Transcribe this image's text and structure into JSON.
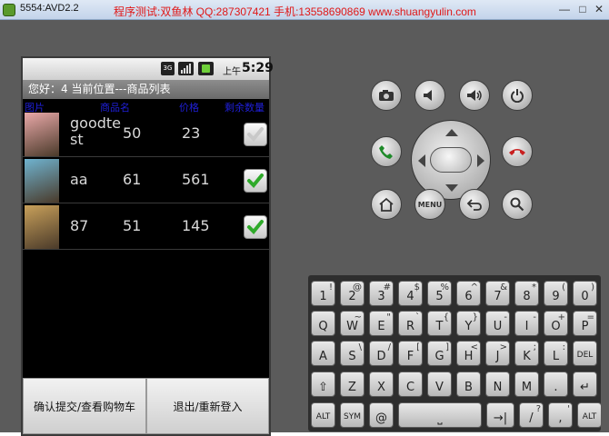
{
  "window": {
    "title": "5554:AVD2.2",
    "overlay": "程序测试:双鱼林 QQ:287307421 手机:13558690869 www.shuangyulin.com",
    "min_glyph": "—",
    "max_glyph": "□",
    "close_glyph": "✕"
  },
  "statusbar": {
    "network": "3G",
    "ampm": "上午",
    "time": "5:29"
  },
  "app": {
    "title_bar": "您好：4   当前位置---商品列表",
    "columns": [
      "图片",
      "商品名",
      "价格",
      "剩余数量"
    ],
    "rows": [
      {
        "name": "goodte st",
        "qty": "50",
        "price": "23",
        "checked": false,
        "thumb_color": "#e9a8a8"
      },
      {
        "name": "aa",
        "qty": "61",
        "price": "561",
        "checked": true,
        "thumb_color": "#6fb3d0"
      },
      {
        "name": "87",
        "qty": "51",
        "price": "145",
        "checked": true,
        "thumb_color": "#c8a05a"
      }
    ],
    "buttons": {
      "confirm": "确认提交/查看购物车",
      "logout": "退出/重新登入"
    }
  },
  "hardware": {
    "menu_label": "MENU"
  },
  "keyboard": {
    "rows": [
      [
        {
          "m": "1",
          "a": "!"
        },
        {
          "m": "2",
          "a": "@"
        },
        {
          "m": "3",
          "a": "#"
        },
        {
          "m": "4",
          "a": "$"
        },
        {
          "m": "5",
          "a": "%"
        },
        {
          "m": "6",
          "a": "^"
        },
        {
          "m": "7",
          "a": "&"
        },
        {
          "m": "8",
          "a": "*"
        },
        {
          "m": "9",
          "a": "("
        },
        {
          "m": "0",
          "a": ")"
        }
      ],
      [
        {
          "m": "Q",
          "a": ""
        },
        {
          "m": "W",
          "a": "~"
        },
        {
          "m": "E",
          "a": "\""
        },
        {
          "m": "R",
          "a": "`"
        },
        {
          "m": "T",
          "a": "{"
        },
        {
          "m": "Y",
          "a": "}"
        },
        {
          "m": "U",
          "a": "-"
        },
        {
          "m": "I",
          "a": "-"
        },
        {
          "m": "O",
          "a": "+"
        },
        {
          "m": "P",
          "a": "="
        }
      ],
      [
        {
          "m": "A",
          "a": ""
        },
        {
          "m": "S",
          "a": "\\"
        },
        {
          "m": "D",
          "a": "/"
        },
        {
          "m": "F",
          "a": "["
        },
        {
          "m": "G",
          "a": "]"
        },
        {
          "m": "H",
          "a": "<"
        },
        {
          "m": "J",
          "a": ">"
        },
        {
          "m": "K",
          "a": ";"
        },
        {
          "m": "L",
          "a": ":"
        },
        {
          "m": "DEL",
          "a": ""
        }
      ],
      [
        {
          "m": "⇧",
          "a": ""
        },
        {
          "m": "Z",
          "a": ""
        },
        {
          "m": "X",
          "a": ""
        },
        {
          "m": "C",
          "a": ""
        },
        {
          "m": "V",
          "a": ""
        },
        {
          "m": "B",
          "a": ""
        },
        {
          "m": "N",
          "a": ""
        },
        {
          "m": "M",
          "a": ""
        },
        {
          "m": ".",
          "a": ""
        },
        {
          "m": "↵",
          "a": ""
        }
      ],
      [
        {
          "m": "ALT",
          "a": ""
        },
        {
          "m": "SYM",
          "a": ""
        },
        {
          "m": "@",
          "a": ""
        },
        {
          "m": "⎵",
          "a": ""
        },
        {
          "m": "→|",
          "a": ""
        },
        {
          "m": "/",
          "a": "?"
        },
        {
          "m": ",",
          "a": "'"
        },
        {
          "m": "ALT",
          "a": ""
        }
      ]
    ]
  }
}
